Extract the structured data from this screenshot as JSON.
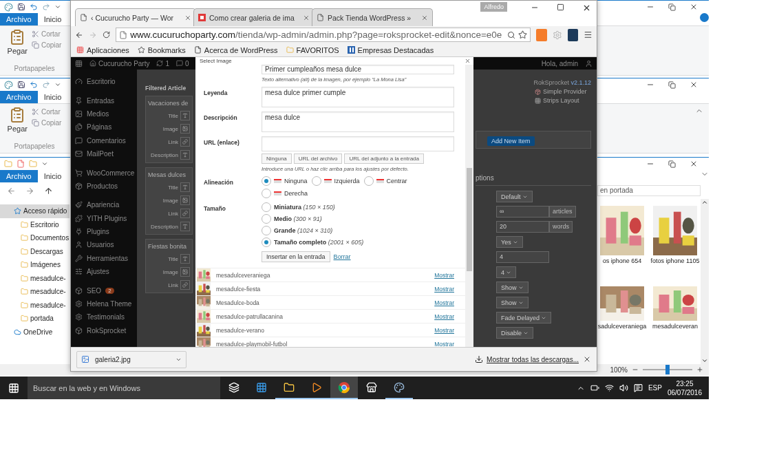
{
  "paint_windows": [
    {
      "tabs": [
        {
          "label": "Archivo",
          "selected": true
        },
        {
          "label": "Inicio",
          "selected": false
        }
      ],
      "paste": "Pegar",
      "cut": "Cortar",
      "copy": "Copiar",
      "group": "Portapapeles"
    },
    {
      "tabs": [
        {
          "label": "Archivo",
          "selected": true
        },
        {
          "label": "Inicio",
          "selected": false
        }
      ],
      "paste": "Pegar",
      "cut": "Cortar",
      "copy": "Copiar",
      "group": "Portapapeles"
    }
  ],
  "explorer": {
    "tabs": [
      {
        "label": "Archivo",
        "selected": true
      },
      {
        "label": "Inicio",
        "selected": false
      }
    ],
    "nav": [
      {
        "label": "Acceso rápido",
        "kind": "star",
        "selected": true,
        "children": [
          {
            "label": "Escritorio",
            "kind": "folder",
            "selected": false
          },
          {
            "label": "Documentos",
            "kind": "folder",
            "selected": false
          },
          {
            "label": "Descargas",
            "kind": "folder",
            "selected": false
          },
          {
            "label": "Imágenes",
            "kind": "folder",
            "selected": false
          },
          {
            "label": "mesadulce-",
            "kind": "folder",
            "selected": false
          },
          {
            "label": "mesadulce-",
            "kind": "folder",
            "selected": false
          },
          {
            "label": "mesadulce-",
            "kind": "folder",
            "selected": false
          },
          {
            "label": "portada",
            "kind": "folder",
            "selected": false
          }
        ]
      },
      {
        "label": "OneDrive",
        "kind": "cloud",
        "selected": false
      }
    ],
    "search": "en portada",
    "thumbnails": [
      {
        "label": "os iphone 654"
      },
      {
        "label": "fotos iphone 1105"
      },
      {
        "label": "sadulceveraniega"
      },
      {
        "label": "mesadulceveran"
      }
    ],
    "zoom": "100%",
    "zoom_slider": {
      "level": 0.5
    }
  },
  "browser": {
    "user": "Alfredo",
    "tabs": [
      {
        "title": "‹ Cucurucho Party — Wor",
        "kind": "page",
        "selected": true
      },
      {
        "title": "Como crear galeria de ima",
        "kind": "brand",
        "selected": false
      },
      {
        "title": "Pack Tienda WordPress »",
        "kind": "page",
        "selected": false
      }
    ],
    "url_host": "www.cucuruchoparty.com",
    "url_path": "/tienda/wp-admin/admin.php?page=roksprocket-edit&nonce=e0e",
    "bookmarks": [
      {
        "label": "Aplicaciones",
        "kind": "apps"
      },
      {
        "label": "Bookmarks",
        "kind": "star"
      },
      {
        "label": "Acerca de WordPress",
        "kind": "page"
      },
      {
        "label": "FAVORITOS",
        "kind": "folder"
      },
      {
        "label": "Empresas Destacadas",
        "kind": "ij"
      }
    ],
    "downloads": {
      "file": "galeria2.jpg",
      "show_all": "Mostrar todas las descargas..."
    }
  },
  "wp": {
    "site": "Cucurucho Party",
    "updates": "1",
    "comments": "0",
    "greeting": "Hola, admin",
    "menu_groups": [
      [
        {
          "label": "Escritorio",
          "kind": "dashboard"
        }
      ],
      [
        {
          "label": "Entradas",
          "kind": "pin"
        },
        {
          "label": "Medios",
          "kind": "media"
        },
        {
          "label": "Páginas",
          "kind": "pages"
        },
        {
          "label": "Comentarios",
          "kind": "comments"
        },
        {
          "label": "MailPoet",
          "kind": "mail"
        }
      ],
      [
        {
          "label": "WooCommerce",
          "kind": "woo"
        },
        {
          "label": "Productos",
          "kind": "products"
        }
      ],
      [
        {
          "label": "Apariencia",
          "kind": "brush"
        },
        {
          "label": "YITH Plugins",
          "kind": "puzzle"
        },
        {
          "label": "Plugins",
          "kind": "plug"
        },
        {
          "label": "Usuarios",
          "kind": "user"
        },
        {
          "label": "Herramientas",
          "kind": "wrench"
        },
        {
          "label": "Ajustes",
          "kind": "settings"
        }
      ],
      [
        {
          "label": "SEO",
          "kind": "seo",
          "badge": "2"
        },
        {
          "label": "Helena Theme",
          "kind": "gear"
        },
        {
          "label": "Testimonials",
          "kind": "gear"
        },
        {
          "label": "RokSprocket",
          "kind": "box"
        }
      ]
    ],
    "panel_title": "Filtered Article",
    "sections": [
      {
        "title": "Vacaciones de",
        "fields": [
          "Title",
          "Image",
          "Link",
          "Description"
        ]
      },
      {
        "title": "Mesas dulces",
        "fields": [
          "Title",
          "Image",
          "Link",
          "Description"
        ]
      },
      {
        "title": "Fiestas bonita",
        "fields": [
          "Title",
          "Image",
          "Link"
        ]
      }
    ],
    "version_name": "RokSprocket",
    "version": "v2.1.12",
    "providers": [
      "Simple Provider",
      "Strips Layout"
    ],
    "add_button": "Add New Item",
    "options_heading": "ptions",
    "options": [
      {
        "kind": "select",
        "value": "Default"
      },
      {
        "kind": "input",
        "value": "∞",
        "addon": "articles"
      },
      {
        "kind": "input",
        "value": "20",
        "addon": "words"
      },
      {
        "kind": "select",
        "value": "Yes"
      },
      {
        "kind": "input",
        "value": "4"
      },
      {
        "kind": "select",
        "value": "4"
      },
      {
        "kind": "select",
        "value": "Show"
      },
      {
        "kind": "select",
        "value": "Show"
      },
      {
        "kind": "select",
        "value": "Fade Delayed"
      },
      {
        "kind": "select",
        "value": "Disable"
      }
    ]
  },
  "dialog": {
    "title": "Select Image",
    "alt_value": "Primer cumpleaños mesa dulce",
    "alt_help": "Texto alternativo (alt) de la imagen, por ejemplo “La Mona Lisa”",
    "caption_label": "Leyenda",
    "caption": "mesa dulce primer cumple",
    "description_label": "Descripción",
    "description": "mesa dulce",
    "url_label": "URL (enlace)",
    "url_buttons": [
      "Ninguna",
      "URL del archivo",
      "URL del adjunto a la entrada"
    ],
    "url_help": "Introduce una URL o haz clic arriba para los ajustes por defecto.",
    "align_label": "Alineación",
    "align": [
      {
        "label": "Ninguna",
        "selected": true
      },
      {
        "label": "Izquierda",
        "selected": false
      },
      {
        "label": "Centrar",
        "selected": false
      },
      {
        "label": "Derecha",
        "selected": false
      }
    ],
    "size_label": "Tamaño",
    "sizes": [
      {
        "label": "Miniatura",
        "dims": "(150 × 150)",
        "selected": false
      },
      {
        "label": "Medio",
        "dims": "(300 × 91)",
        "selected": false
      },
      {
        "label": "Grande",
        "dims": "(1024 × 310)",
        "selected": false
      },
      {
        "label": "Tamaño completo",
        "dims": "(2001 × 605)",
        "selected": true
      }
    ],
    "insert": "Insertar en la entrada",
    "delete": "Borrar",
    "media": [
      {
        "name": "mesadulceveraniega",
        "action": "Mostrar"
      },
      {
        "name": "mesadulce-fiesta",
        "action": "Mostrar"
      },
      {
        "name": "Mesadulce-boda",
        "action": "Mostrar"
      },
      {
        "name": "mesadulce-patrullacanina",
        "action": "Mostrar"
      },
      {
        "name": "mesadulce-verano",
        "action": "Mostrar"
      },
      {
        "name": "mesadulce-playmobil-futbol",
        "action": "Mostrar"
      }
    ]
  },
  "taskbar": {
    "search": "Buscar en la web y en Windows",
    "apps": [
      {
        "kind": "taskview",
        "running": false,
        "selected": false
      },
      {
        "kind": "edge",
        "running": false,
        "selected": false
      },
      {
        "kind": "explorer",
        "running": true,
        "selected": false
      },
      {
        "kind": "media",
        "running": true,
        "selected": false
      },
      {
        "kind": "chrome",
        "running": true,
        "selected": true
      },
      {
        "kind": "store",
        "running": false,
        "selected": false
      },
      {
        "kind": "paint",
        "running": true,
        "selected": false
      }
    ],
    "language": "ESP",
    "time": "23:25",
    "date": "06/07/2016"
  }
}
